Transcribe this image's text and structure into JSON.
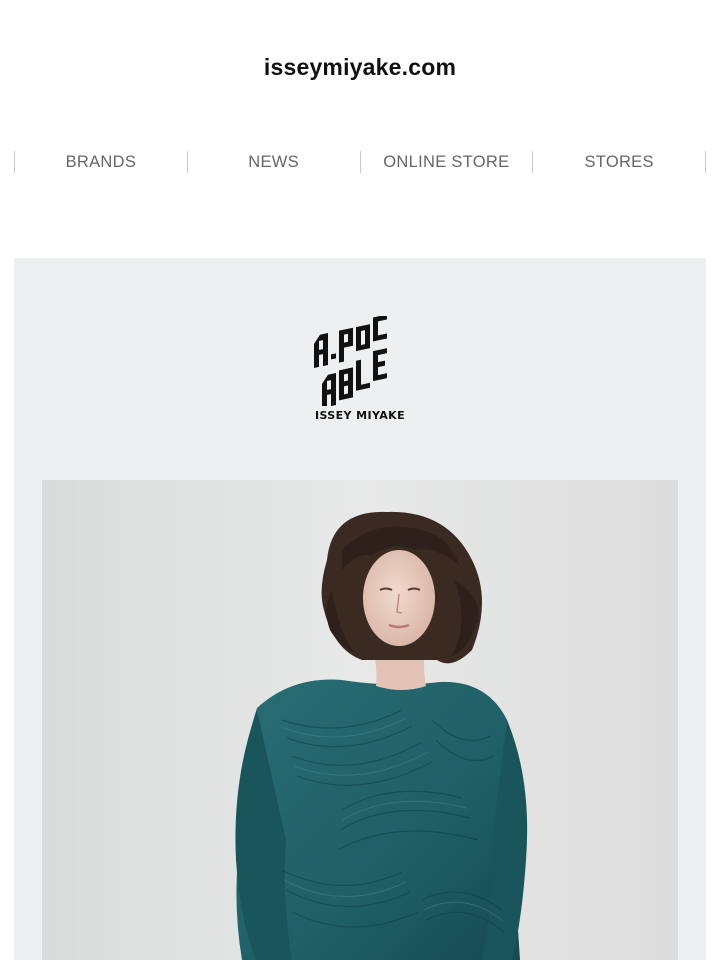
{
  "site": {
    "title": "isseymiyake.com"
  },
  "nav": {
    "items": [
      {
        "label": "BRANDS"
      },
      {
        "label": "NEWS"
      },
      {
        "label": "ONLINE STORE"
      },
      {
        "label": "STORES"
      }
    ]
  },
  "brand": {
    "logo_text": "A-POC ABLE",
    "caption": "ISSEY MIYAKE"
  },
  "hero": {
    "garment_color": "#1f5f66",
    "background_color": "#e3e4e4"
  }
}
